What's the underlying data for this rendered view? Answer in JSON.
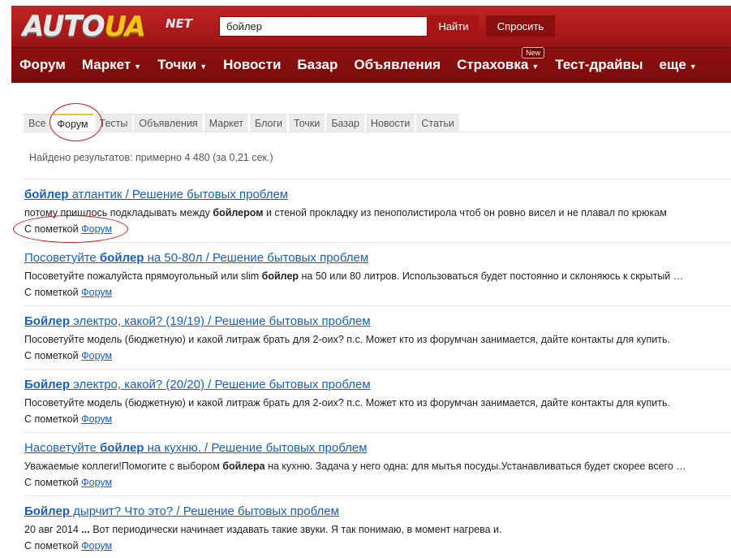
{
  "header": {
    "logo": {
      "part1": "AUTO",
      "part2": "UA",
      "part3": "NET"
    },
    "search": {
      "value": "бойлер"
    },
    "find_label": "Найти",
    "ask_label": "Спросить",
    "nav": [
      {
        "label": "Форум",
        "caret": ""
      },
      {
        "label": "Маркет",
        "caret": "▼"
      },
      {
        "label": "Точки",
        "caret": "▼"
      },
      {
        "label": "Новости",
        "caret": ""
      },
      {
        "label": "Базар",
        "caret": ""
      },
      {
        "label": "Объявления",
        "caret": ""
      },
      {
        "label": "Страховка",
        "caret": "▼",
        "badge": "New"
      },
      {
        "label": "Тест-драйвы",
        "caret": ""
      },
      {
        "label": "еще",
        "caret": "▼"
      }
    ]
  },
  "tabs": [
    "Все",
    "Форум",
    "Тесты",
    "Объявления",
    "Маркет",
    "Блоги",
    "Точки",
    "Базар",
    "Новости",
    "Статьи"
  ],
  "active_tab": "Форум",
  "results_count": "Найдено результатов: примерно 4 480 (за 0,21 сек.)",
  "tag_prefix": "С пометкой",
  "tag_label": "Форум",
  "results": [
    {
      "title_bold": "бойлер",
      "title_rest": " атлантик / Решение бытовых проблем",
      "snippet_html": "потому пришлось подкладывать между <b>бойлером</b> и стеной прокладку из пенополистирола чтоб он ровно висел и не плавал по крюкам"
    },
    {
      "title_pre": "Посоветуйте ",
      "title_bold": "бойлер",
      "title_rest": " на 50-80л / Решение бытовых проблем",
      "snippet_html": "Посоветуйте пожалуйста прямоугольный или slim <b>бойлер</b> на 50 или 80 литров. Использоваться будет постоянно и склоняюсь к скрытый …"
    },
    {
      "title_bold": "Бойлер",
      "title_rest": " электро, какой? (19/19) / Решение бытовых проблем",
      "snippet_html": "Посоветуйте модель (бюджетную) и какой литраж брать для 2-оих? п.с. Может кто из форумчан занимается, дайте контакты для купить."
    },
    {
      "title_bold": "Бойлер",
      "title_rest": " электро, какой? (20/20) / Решение бытовых проблем",
      "snippet_html": "Посоветуйте модель (бюджетную) и какой литраж брать для 2-оих? п.с. Может кто из форумчан занимается, дайте контакты для купить."
    },
    {
      "title_pre": "Насоветуйте ",
      "title_bold": "бойлер",
      "title_rest": " на кухню. / Решение бытовых проблем",
      "snippet_html": "Уважаемые коллеги!Помогите с выбором <b>бойлера</b> на кухню. Задача у него одна: для мытья посуды.Устанавливаться будет скорее всего …"
    },
    {
      "title_bold": "Бойлер",
      "title_rest": " дырчит? Что это? / Решение бытовых проблем",
      "snippet_html": "20 авг 2014 <b>...</b> Вот периодически начинает издавать такие звуки. Я так понимаю, в момент нагрева и."
    }
  ],
  "colors": {
    "header_red": "#9a1414",
    "link_blue": "#1a5fb4",
    "annotation_red": "#c21b1b",
    "tab_accent": "#f0c020"
  }
}
